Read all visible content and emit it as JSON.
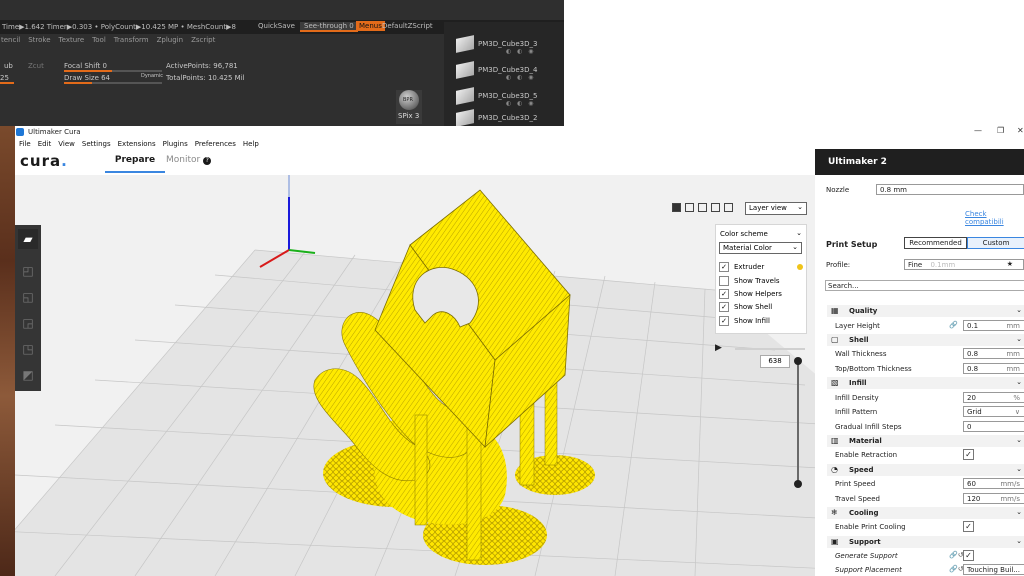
{
  "zbrush": {
    "topbar": [
      "Time▶1.642 Timer▶0.303 • PolyCount▶10.425 MP • MeshCount▶8"
    ],
    "quicksave": "QuickSave",
    "see_through": "See-through  0",
    "menus": "Menus",
    "default_zscript": "DefaultZScript",
    "menu_items": [
      "tencil",
      "Stroke",
      "Texture",
      "Tool",
      "Transform",
      "Zplugin",
      "Zscript"
    ],
    "sub": "ub",
    "zcut": "Zcut",
    "focal_shift": "Focal Shift 0",
    "draw_size": "Draw Size 64",
    "dynamic": "Dynamic",
    "active_points": "ActivePoints: 96,781",
    "total_points": "TotalPoints: 10.425 Mil",
    "left_value": "25",
    "spix": "SPix 3",
    "spix_ball": "BPR",
    "subtools": [
      {
        "name": "PM3D_Cube3D_3"
      },
      {
        "name": "PM3D_Cube3D_4"
      },
      {
        "name": "PM3D_Cube3D_5"
      },
      {
        "name": "PM3D_Cube3D_2"
      }
    ]
  },
  "cura": {
    "window_title": "Ultimaker Cura",
    "window_controls": [
      "—",
      "❐",
      "✕"
    ],
    "menu": [
      "File",
      "Edit",
      "View",
      "Settings",
      "Extensions",
      "Plugins",
      "Preferences",
      "Help"
    ],
    "logo": "cura",
    "logo_dot": ".",
    "tabs": {
      "prepare": "Prepare",
      "monitor": "Monitor"
    },
    "monitor_help": "?",
    "view_mode": "Layer view",
    "color_scheme": {
      "title": "Color scheme",
      "selected": "Material Color",
      "options": [
        {
          "label": "Extruder",
          "checked": true,
          "dot": "#f0c419"
        },
        {
          "label": "Show Travels",
          "checked": false
        },
        {
          "label": "Show Helpers",
          "checked": true
        },
        {
          "label": "Show Shell",
          "checked": true
        },
        {
          "label": "Show Infill",
          "checked": true
        }
      ]
    },
    "layer_number": "638",
    "model_color": "#ffea00",
    "printer": "Ultimaker 2",
    "nozzle_label": "Nozzle",
    "nozzle_value": "0.8 mm",
    "check_compat": "Check compatibili",
    "print_setup": "Print Setup",
    "mode_recommended": "Recommended",
    "mode_custom": "Custom",
    "profile_label": "Profile:",
    "profile_value": "Fine",
    "profile_hint": "0.1mm",
    "search_placeholder": "Search...",
    "sections": [
      {
        "name": "Quality",
        "icon": "▦",
        "settings": [
          {
            "name": "Layer Height",
            "value": "0.1",
            "unit": "mm",
            "link": true
          }
        ]
      },
      {
        "name": "Shell",
        "icon": "▢",
        "settings": [
          {
            "name": "Wall Thickness",
            "value": "0.8",
            "unit": "mm"
          },
          {
            "name": "Top/Bottom Thickness",
            "value": "0.8",
            "unit": "mm"
          }
        ]
      },
      {
        "name": "Infill",
        "icon": "▧",
        "settings": [
          {
            "name": "Infill Density",
            "value": "20",
            "unit": "%"
          },
          {
            "name": "Infill Pattern",
            "value": "Grid",
            "unit": "∨"
          },
          {
            "name": "Gradual Infill Steps",
            "value": "0",
            "unit": ""
          }
        ]
      },
      {
        "name": "Material",
        "icon": "▥",
        "settings": [
          {
            "name": "Enable Retraction",
            "check": true
          }
        ]
      },
      {
        "name": "Speed",
        "icon": "◔",
        "settings": [
          {
            "name": "Print Speed",
            "value": "60",
            "unit": "mm/s"
          },
          {
            "name": "Travel Speed",
            "value": "120",
            "unit": "mm/s"
          }
        ]
      },
      {
        "name": "Cooling",
        "icon": "❄",
        "settings": [
          {
            "name": "Enable Print Cooling",
            "check": true
          }
        ]
      },
      {
        "name": "Support",
        "icon": "▣",
        "settings": [
          {
            "name": "Generate Support",
            "check": true,
            "italic": true
          },
          {
            "name": "Support Placement",
            "value": "Touching Buil...",
            "unit": "",
            "italic": true
          }
        ]
      }
    ]
  }
}
